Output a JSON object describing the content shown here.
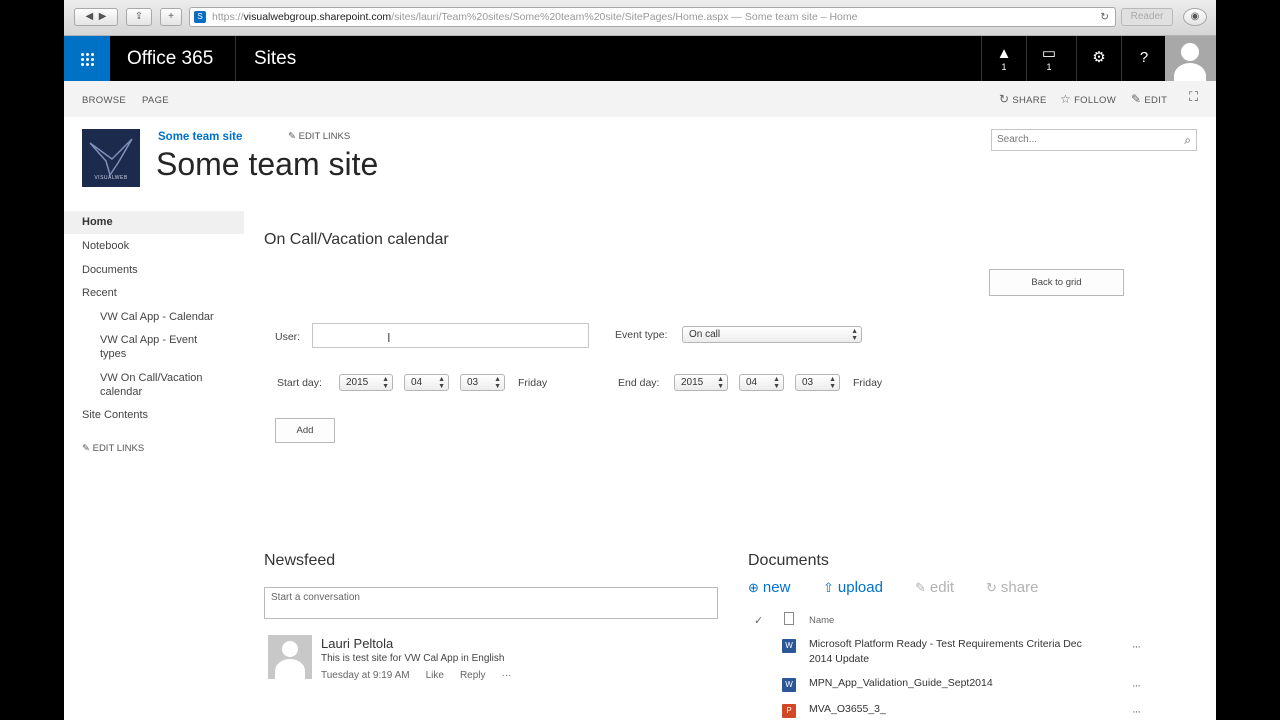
{
  "browser": {
    "url_scheme": "https://",
    "url_domain": "visualwebgroup.sharepoint.com",
    "url_path": "/sites/lauri/Team%20sites/Some%20team%20site/SitePages/Home.aspx — Some team site – Home",
    "reader_label": "Reader",
    "favicon_letter": "S"
  },
  "suite": {
    "brand": "Office 365",
    "sites": "Sites",
    "alerts_count": "1",
    "notes_count": "1",
    "help": "?"
  },
  "ribbon": {
    "browse": "BROWSE",
    "page": "PAGE",
    "share": "SHARE",
    "follow": "FOLLOW",
    "edit": "EDIT"
  },
  "header": {
    "logo_text": "VISUALWEB",
    "breadcrumb": "Some team site",
    "edit_links": "EDIT LINKS",
    "title": "Some team site",
    "search_placeholder": "Search..."
  },
  "nav": {
    "home": "Home",
    "notebook": "Notebook",
    "documents": "Documents",
    "recent": "Recent",
    "recent_items": [
      "VW Cal App - Calendar",
      "VW Cal App - Event types",
      "VW On Call/Vacation calendar"
    ],
    "site_contents": "Site Contents",
    "edit_links": "EDIT LINKS"
  },
  "calendar": {
    "title": "On Call/Vacation calendar",
    "back_button": "Back to grid",
    "user_label": "User:",
    "user_value": "",
    "event_type_label": "Event type:",
    "event_type_value": "On call",
    "start_label": "Start day:",
    "start_year": "2015",
    "start_month": "04",
    "start_day": "03",
    "start_weekday": "Friday",
    "end_label": "End day:",
    "end_year": "2015",
    "end_month": "04",
    "end_day": "03",
    "end_weekday": "Friday",
    "add_button": "Add"
  },
  "newsfeed": {
    "title": "Newsfeed",
    "input_placeholder": "Start a conversation",
    "post": {
      "author": "Lauri Peltola",
      "text": "This is test site for VW Cal App in English",
      "time": "Tuesday at 9:19 AM",
      "like": "Like",
      "reply": "Reply",
      "more": "···"
    }
  },
  "documents": {
    "title": "Documents",
    "new": "new",
    "upload": "upload",
    "edit": "edit",
    "share": "share",
    "col_name": "Name",
    "rows": [
      {
        "name": "Microsoft Platform Ready - Test Requirements Criteria Dec 2014 Update",
        "icon": "word-doc-icon",
        "color": "#2b5797"
      },
      {
        "name": "MPN_App_Validation_Guide_Sept2014",
        "icon": "word-doc-icon",
        "color": "#2b5797"
      },
      {
        "name": "MVA_O3655_3_",
        "icon": "powerpoint-icon",
        "color": "#d24726"
      }
    ],
    "more": "···"
  },
  "colors": {
    "accent": "#0072c6",
    "suite_bar": "#000000",
    "ribbon": "#f3f3f3"
  }
}
